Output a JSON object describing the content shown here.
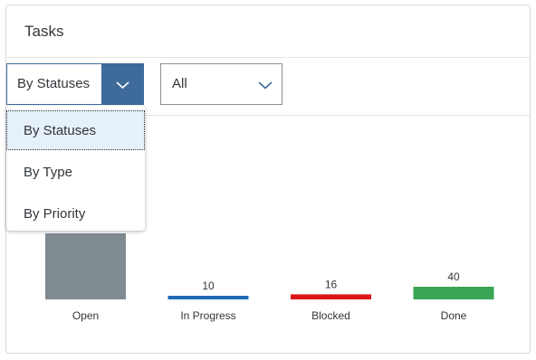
{
  "card": {
    "title": "Tasks"
  },
  "toolbar": {
    "group_by": {
      "value": "By Statuses",
      "options": [
        "By Statuses",
        "By Type",
        "By Priority"
      ],
      "selected_index": 0
    },
    "filter": {
      "value": "All"
    }
  },
  "colors": {
    "accent": "#3f6b9a",
    "open": "#808b91",
    "in_progress": "#1f6ab5",
    "blocked": "#dc1616",
    "done": "#3aa655"
  },
  "chart_data": {
    "type": "bar",
    "categories": [
      "Open",
      "In Progress",
      "Blocked",
      "Done"
    ],
    "values": [
      null,
      10,
      16,
      40
    ],
    "data_labels": [
      "",
      "10",
      "16",
      "40"
    ],
    "colors": [
      "#808b91",
      "#1f6ab5",
      "#dc1616",
      "#3aa655"
    ],
    "title": "",
    "xlabel": "",
    "ylabel": ""
  }
}
